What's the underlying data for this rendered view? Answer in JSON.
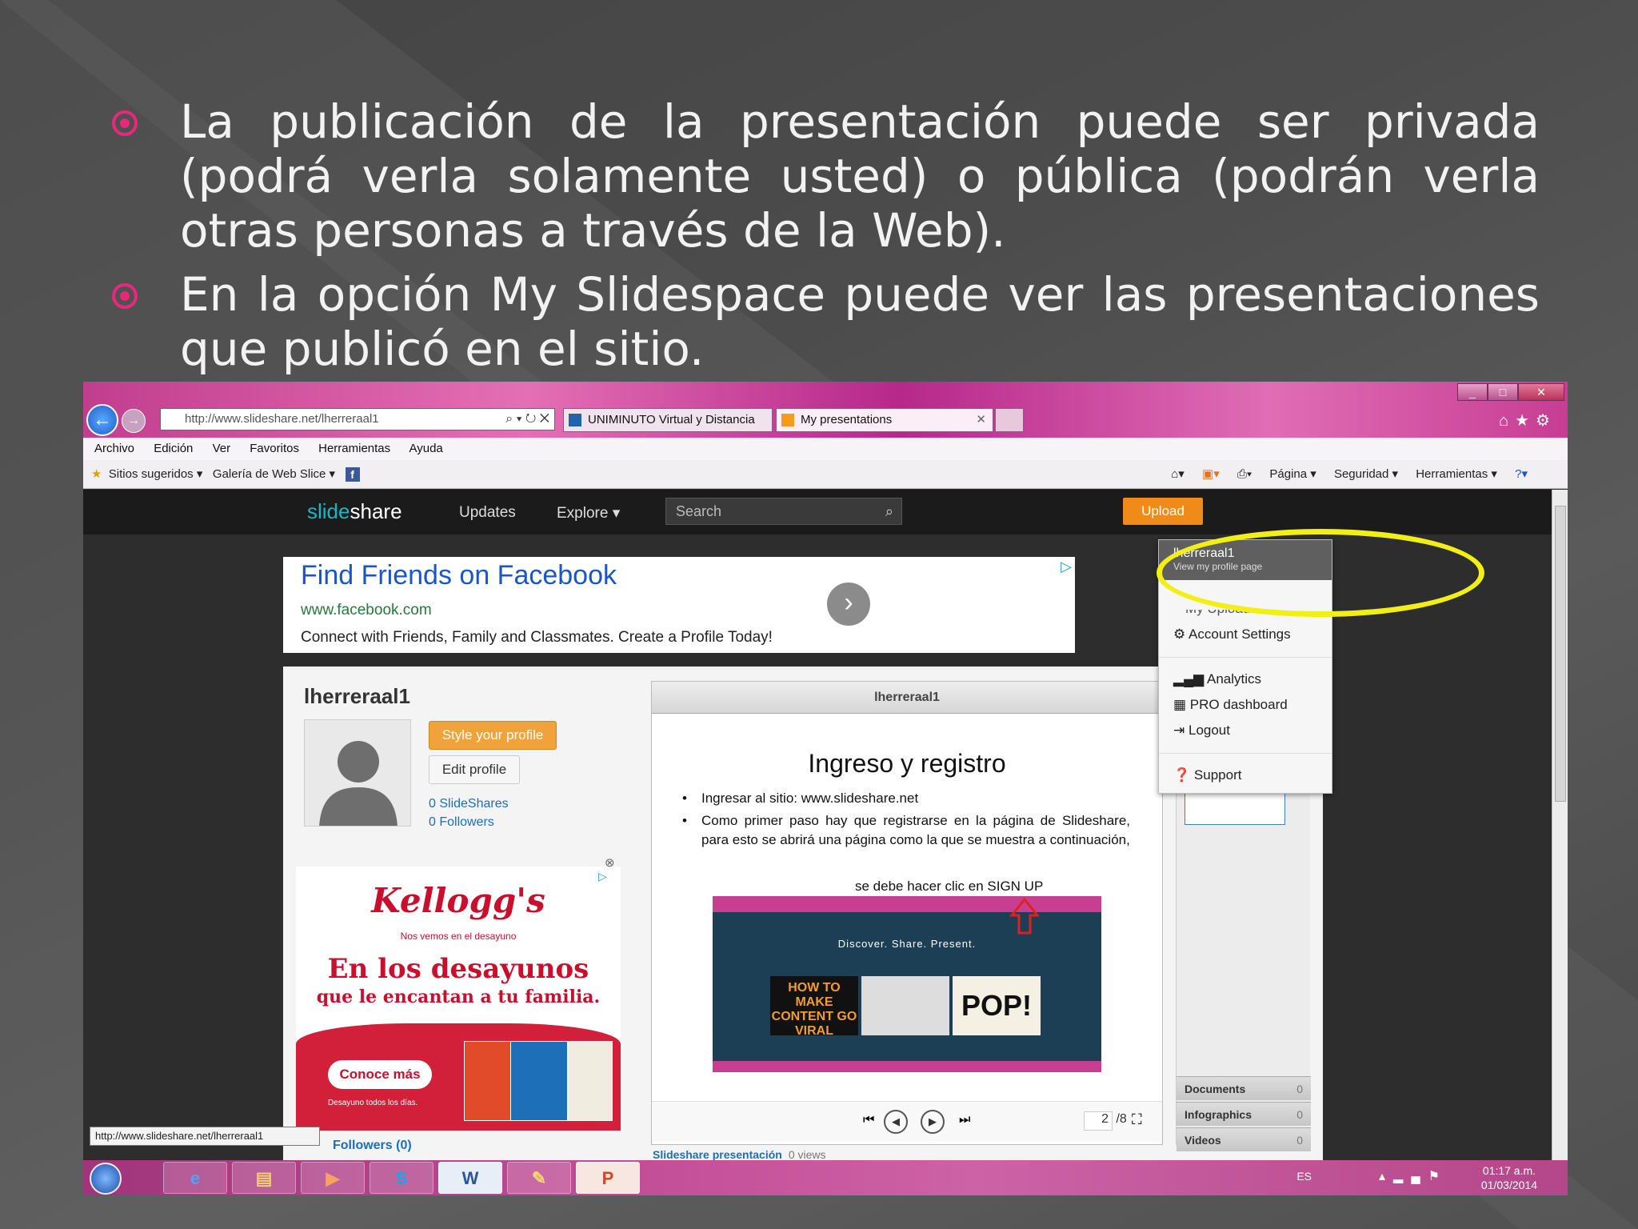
{
  "slide": {
    "bullets": [
      "La publicación de la presentación puede ser privada (podrá verla solamente usted) o pública (podrán verla otras personas a través de la Web).",
      "En la opción My Slidespace puede ver las presentaciones que publicó en el sitio."
    ],
    "bullet_color": "#e8287a"
  },
  "browser": {
    "address": "http://www.slideshare.net/lherreraal1",
    "address_host_bold": "slideshare.net",
    "tabs": [
      "UNIMINUTO Virtual y Distancia",
      "My presentations"
    ],
    "menu": [
      "Archivo",
      "Edición",
      "Ver",
      "Favoritos",
      "Herramientas",
      "Ayuda"
    ],
    "favorites": [
      "Sitios sugeridos ▾",
      "Galería de Web Slice ▾"
    ],
    "command_bar": [
      "Página ▾",
      "Seguridad ▾",
      "Herramientas ▾"
    ],
    "status_tooltip": "http://www.slideshare.net/lherreraal1"
  },
  "slideshare": {
    "logo_a": "slide",
    "logo_b": "share",
    "nav": [
      "Updates",
      "Explore ▾"
    ],
    "search_placeholder": "Search",
    "upload": "Upload",
    "ad": {
      "title": "Find Friends on Facebook",
      "url": "www.facebook.com",
      "desc": "Connect with Friends, Family and Classmates. Create a Profile Today!"
    },
    "profile": {
      "username": "lherreraal1",
      "style_button": "Style your profile",
      "edit_button": "Edit profile",
      "slideshares": "0 SlideShares",
      "followers": "0 Followers",
      "followers_footer": "Followers (0)"
    },
    "kellogg_ad": {
      "brand": "Kellogg's",
      "tagline": "Nos vemos en el desayuno",
      "headline": "En los desayunos",
      "subhead": "que le encantan a tu familia.",
      "cta": "Conoce más",
      "small": "Desayuno todos los días."
    },
    "viewer": {
      "header": "lherreraal1",
      "slide_title": "Ingreso y registro",
      "items": [
        "Ingresar al sitio: www.slideshare.net",
        "Como primer paso hay que registrarse en la página de Slideshare, para esto se abrirá una página como la que se muestra a continuación,"
      ],
      "caption": "se debe hacer clic en SIGN UP",
      "inner_tagline": "Discover. Share. Present.",
      "inner_tile1": "HOW TO MAKE CONTENT GO VIRAL",
      "inner_tile3": "POP!",
      "page_current": "2",
      "page_total": "/8",
      "title_link": "Slideshare presentación",
      "views": "0 views"
    },
    "sidebar_rows": [
      {
        "label": "Documents",
        "count": "0"
      },
      {
        "label": "Infographics",
        "count": "0"
      },
      {
        "label": "Videos",
        "count": "0"
      }
    ],
    "dropdown": {
      "name": "lherreraal1",
      "sub": "View my profile page",
      "partial": "My Uploads",
      "items": [
        "Account Settings",
        "Analytics",
        "PRO dashboard",
        "Logout",
        "Support"
      ]
    }
  },
  "taskbar": {
    "lang": "ES",
    "time": "01:17 a.m.",
    "date": "01/03/2014"
  }
}
